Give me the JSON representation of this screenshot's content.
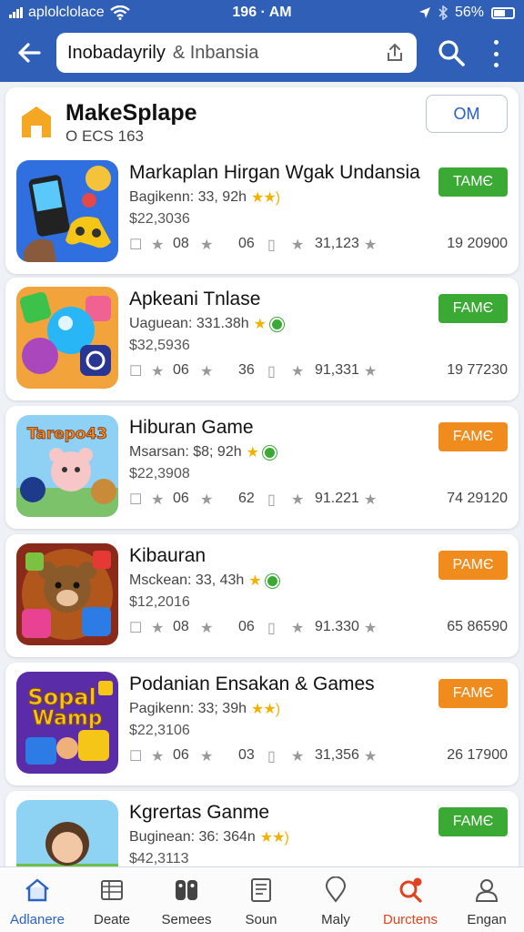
{
  "status": {
    "carrier": "aplolclolace",
    "time": "196 · AM",
    "battery": "56%",
    "icons": [
      "signal-icon",
      "wifi-icon",
      "location-icon",
      "bluetooth-icon",
      "battery-icon"
    ]
  },
  "appbar": {
    "query_primary": "Inobadayrily",
    "query_secondary": "& Inbansia",
    "icons": [
      "back-arrow-icon",
      "share-icon",
      "search-icon",
      "more-vertical-icon"
    ]
  },
  "header": {
    "name": "MakeSplape",
    "subtitle": "O ECS 163",
    "button": "OM"
  },
  "apps": [
    {
      "title": "Markaplan Hirgan Wgak Undansia",
      "sub": "Bagikenn: 33, 92h",
      "badge": "stars",
      "price": "$22,3036",
      "s1": "08",
      "s2": "06",
      "s3": "31,123",
      "s4": "19 20900",
      "action": "TAMЄ",
      "action_color": "#3aaa35"
    },
    {
      "title": "Apkeani Tnlase",
      "sub": "Uaguean: 331.38h",
      "badge": "star-leaf",
      "price": "$32,5936",
      "s1": "06",
      "s2": "36",
      "s3": "91,331",
      "s4": "19 77230",
      "action": "FAMЄ",
      "action_color": "#3aaa35"
    },
    {
      "title": "Hiburan Game",
      "sub": "Msarsan: $8; 92h",
      "badge": "star-leaf",
      "price": "$22,3908",
      "s1": "06",
      "s2": "62",
      "s3": "91.221",
      "s4": "74 29120",
      "action": "FAMЄ",
      "action_color": "#f08c1e"
    },
    {
      "title": "Kibauran",
      "sub": "Msckean: 33, 43h",
      "badge": "star-leaf",
      "price": "$12,2016",
      "s1": "08",
      "s2": "06",
      "s3": "91.330",
      "s4": "65 86590",
      "action": "PAMЄ",
      "action_color": "#f08c1e"
    },
    {
      "title": "Podanian Ensakan & Games",
      "sub": "Pagikenn: 33; 39h",
      "badge": "stars",
      "price": "$22,3106",
      "s1": "06",
      "s2": "03",
      "s3": "31,356",
      "s4": "26 17900",
      "action": "FAMЄ",
      "action_color": "#f08c1e"
    },
    {
      "title": "Kgrertas Ganme",
      "sub": "Buginean: 36: 364n",
      "badge": "stars",
      "price": "$42,3113",
      "s1": "",
      "s2": "",
      "s3": "",
      "s4": "",
      "action": "FAMЄ",
      "action_color": "#3aaa35"
    }
  ],
  "thumb_texts": {
    "app3": "Tarepo43",
    "app5_line1": "Sopal",
    "app5_line2": "Wamp"
  },
  "nav": [
    {
      "label": "Adlanere",
      "icon": "home-icon",
      "active": true
    },
    {
      "label": "Deate",
      "icon": "grid-icon"
    },
    {
      "label": "Semees",
      "icon": "gamepad-icon"
    },
    {
      "label": "Soun",
      "icon": "document-icon"
    },
    {
      "label": "Maly",
      "icon": "location-pin-icon"
    },
    {
      "label": "Durctens",
      "icon": "search-alert-icon",
      "alert": true
    },
    {
      "label": "Engan",
      "icon": "user-icon"
    }
  ]
}
